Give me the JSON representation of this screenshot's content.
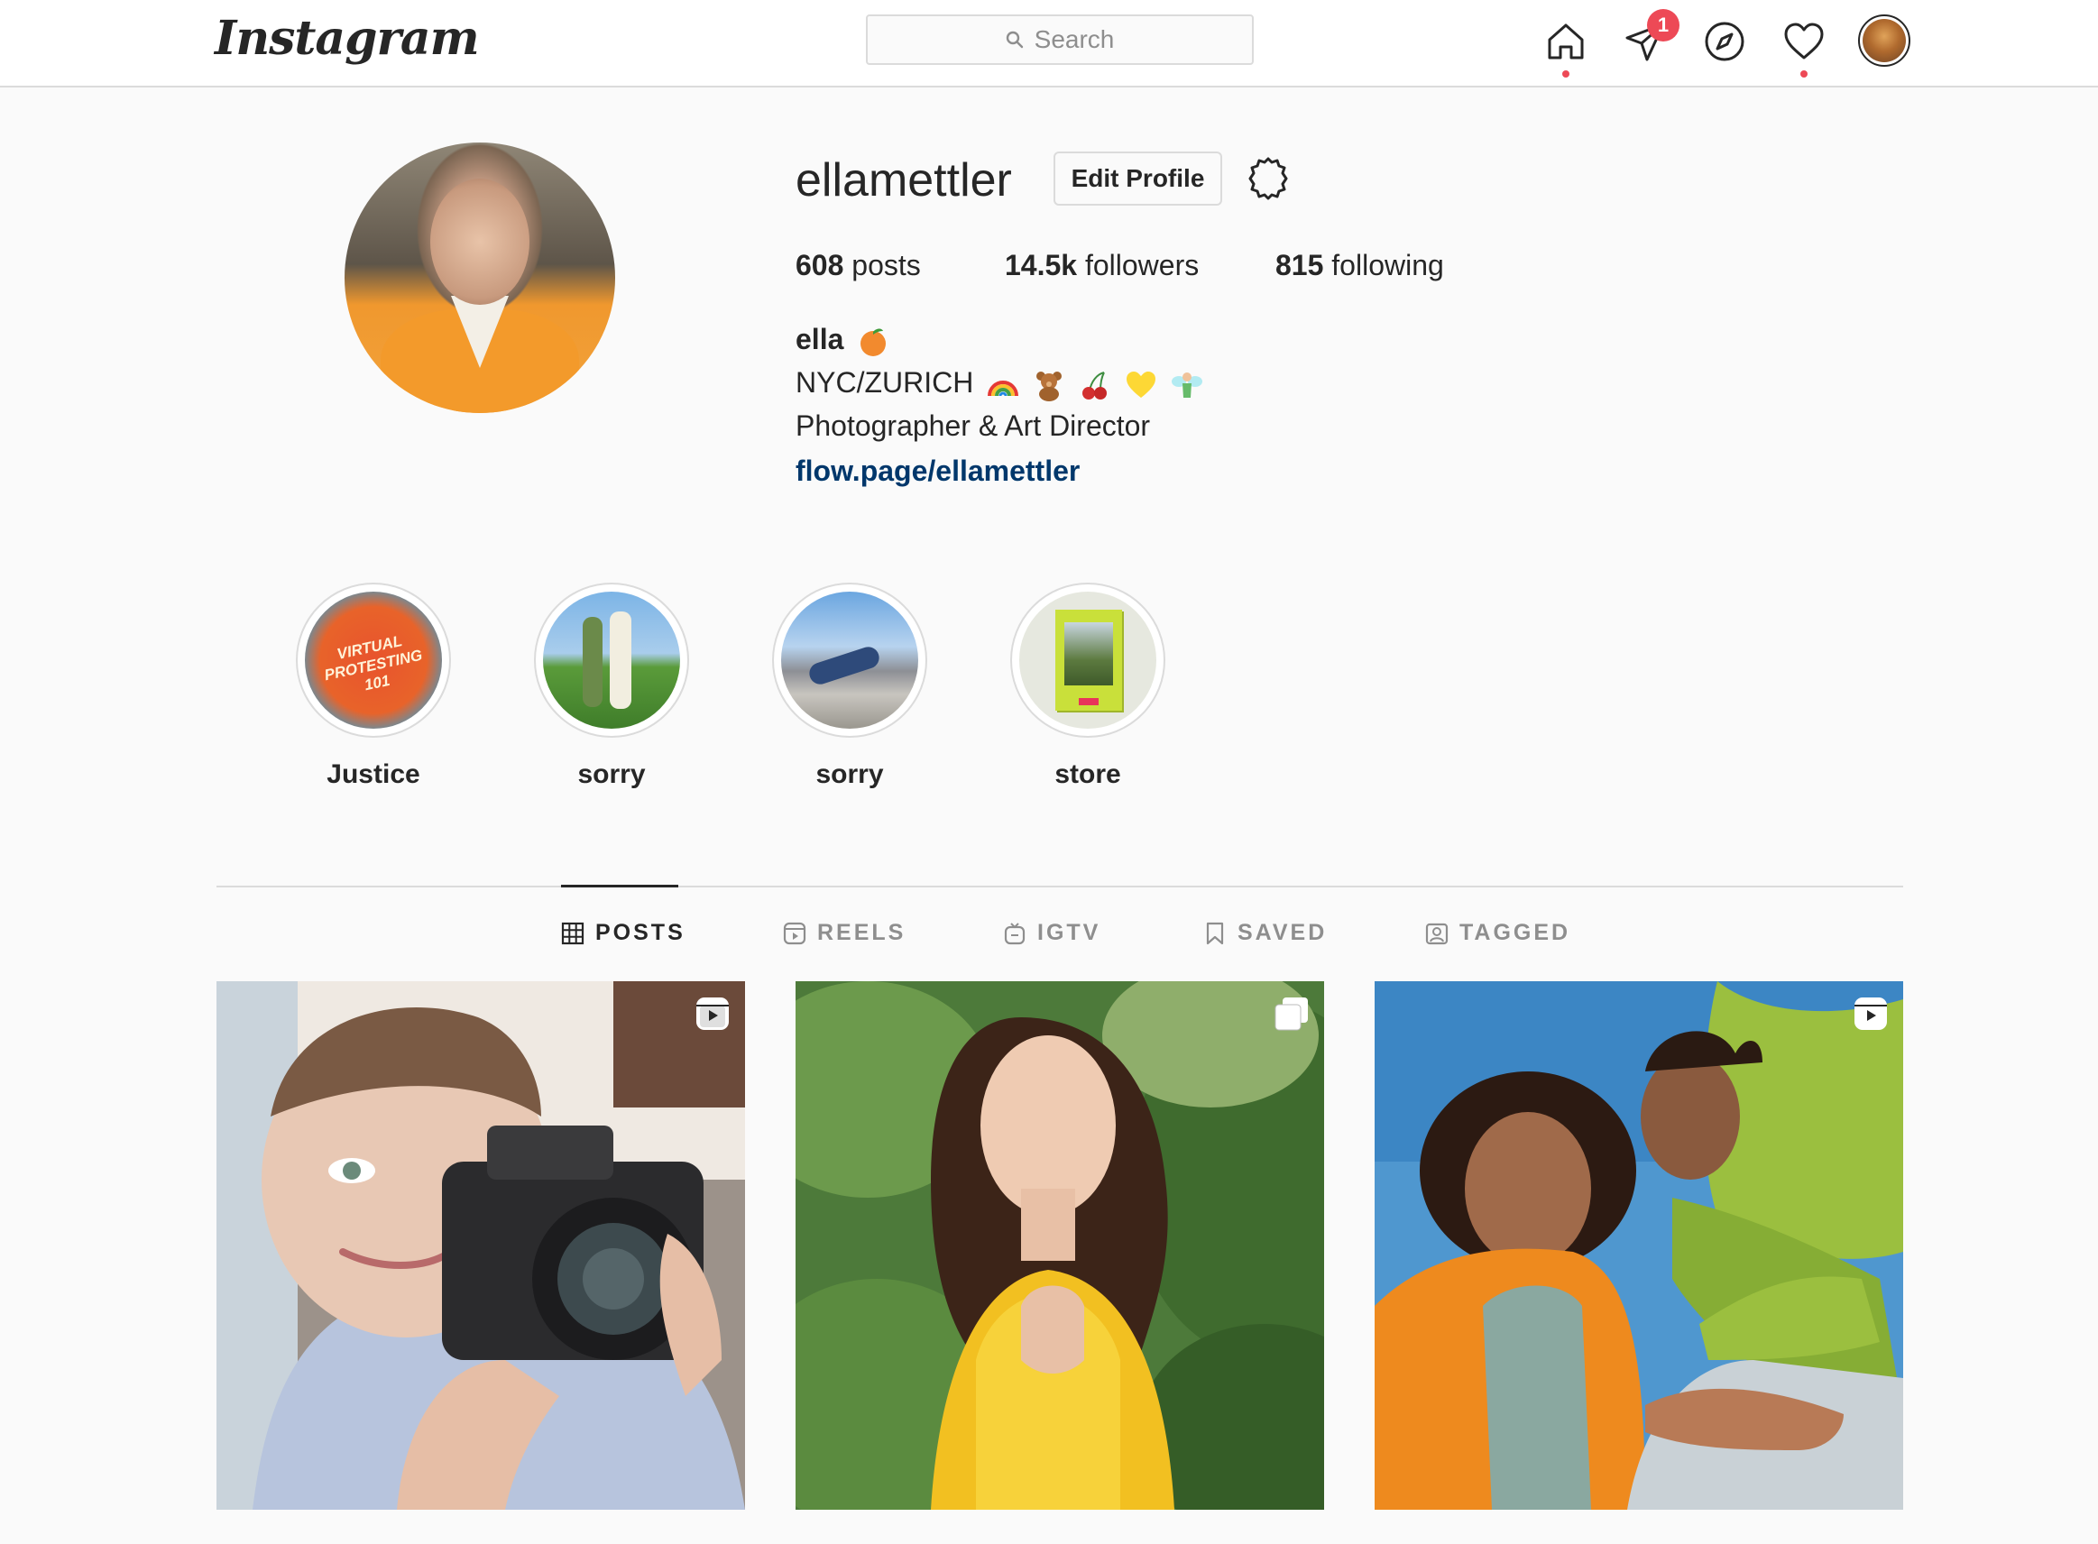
{
  "app": {
    "logo_text": "Instagram"
  },
  "search": {
    "placeholder": "Search"
  },
  "nav": {
    "icons": [
      "home-icon",
      "direct-messages-icon",
      "explore-icon",
      "activity-heart-icon",
      "profile-avatar"
    ],
    "messages_badge": "1"
  },
  "profile": {
    "username": "ellamettler",
    "edit_button": "Edit Profile",
    "stats": {
      "posts_count": "608",
      "posts_label": "posts",
      "followers_count": "14.5k",
      "followers_label": "followers",
      "following_count": "815",
      "following_label": "following"
    },
    "full_name": "ella",
    "full_name_emoji": "peach-emoji",
    "bio_line1": "NYC/ZURICH",
    "bio_line1_emojis": [
      "rainbow-emoji",
      "teddy-bear-emoji",
      "cherries-emoji",
      "yellow-heart-emoji",
      "fairy-emoji"
    ],
    "bio_line2": "Photographer & Art Director",
    "link": "flow.page/ellamettler"
  },
  "highlights": [
    {
      "label": "Justice",
      "cover_text": "VIRTUAL PROTESTING 101"
    },
    {
      "label": "sorry"
    },
    {
      "label": "sorry"
    },
    {
      "label": "store"
    }
  ],
  "tabs": [
    {
      "label": "POSTS",
      "icon": "grid-icon",
      "active": true
    },
    {
      "label": "REELS",
      "icon": "reels-icon",
      "active": false
    },
    {
      "label": "IGTV",
      "icon": "igtv-icon",
      "active": false
    },
    {
      "label": "SAVED",
      "icon": "bookmark-icon",
      "active": false
    },
    {
      "label": "TAGGED",
      "icon": "tagged-icon",
      "active": false
    }
  ],
  "posts": [
    {
      "type_icon": "reel-icon"
    },
    {
      "type_icon": "carousel-icon"
    },
    {
      "type_icon": "reel-icon"
    }
  ],
  "colors": {
    "link": "#00376b",
    "notification": "#ed4956",
    "border": "#dbdbdb",
    "muted": "#8e8e8e"
  }
}
